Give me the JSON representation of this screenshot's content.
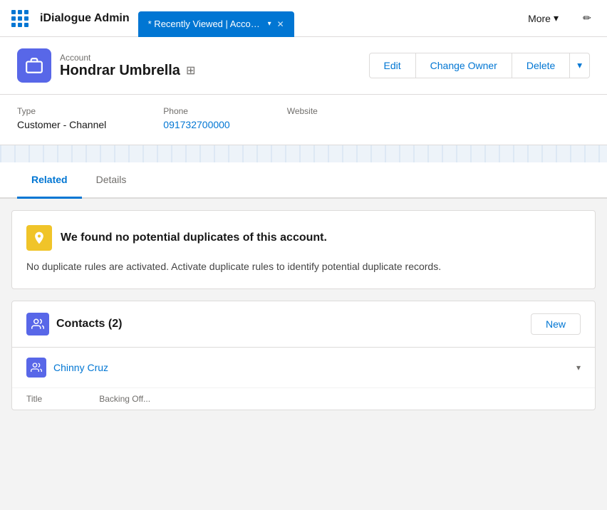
{
  "nav": {
    "app_name": "iDialogue Admin",
    "tab_label": "* Recently Viewed | Accou...",
    "more_label": "More",
    "grid_dots": 9
  },
  "header": {
    "breadcrumb_label": "Account",
    "record_name": "Hondrar Umbrella",
    "edit_label": "Edit",
    "change_owner_label": "Change Owner",
    "delete_label": "Delete"
  },
  "fields": {
    "type_label": "Type",
    "type_value": "Customer - Channel",
    "phone_label": "Phone",
    "phone_value": "091732700000",
    "website_label": "Website"
  },
  "tabs": {
    "related_label": "Related",
    "details_label": "Details"
  },
  "duplicate_notice": {
    "title": "We found no potential duplicates of this account.",
    "body": "No duplicate rules are activated. Activate duplicate rules to identify potential duplicate records."
  },
  "contacts": {
    "title": "Contacts",
    "count": "(2)",
    "new_label": "New",
    "items": [
      {
        "name": "Chinny Cruz"
      }
    ]
  },
  "contact_fields": {
    "title_label": "Title",
    "backing_off_label": "Backing Off..."
  }
}
